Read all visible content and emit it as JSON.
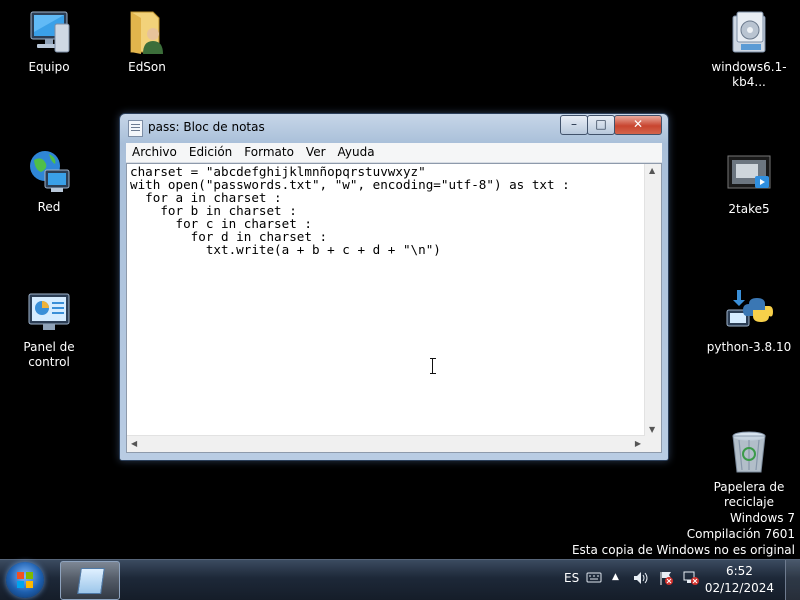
{
  "desktop": {
    "icons": [
      {
        "label": "Equipo",
        "icon": "computer-icon"
      },
      {
        "label": "EdSon",
        "icon": "user-folder-icon"
      },
      {
        "label": "Red",
        "icon": "network-globe-icon"
      },
      {
        "label": "Panel de control",
        "icon": "control-panel-icon"
      },
      {
        "label": "windows6.1-kb4...",
        "icon": "installer-package-icon"
      },
      {
        "label": "2take5",
        "icon": "video-file-icon"
      },
      {
        "label": "python-3.8.10",
        "icon": "python-installer-icon"
      },
      {
        "label": "Papelera de reciclaje",
        "icon": "recycle-bin-icon"
      }
    ],
    "watermark": [
      "Windows 7",
      "Compilación  7601",
      "Esta copia de Windows no es original"
    ]
  },
  "notepad": {
    "title": "pass: Bloc de notas",
    "controls": {
      "minimize": "–",
      "maximize": "□",
      "close": "✕"
    },
    "menu": [
      "Archivo",
      "Edición",
      "Formato",
      "Ver",
      "Ayuda"
    ],
    "content": "charset = \"abcdefghijklmnñopqrstuvwxyz\"\nwith open(\"passwords.txt\", \"w\", encoding=\"utf-8\") as txt :\n  for a in charset :\n    for b in charset :\n      for c in charset :\n        for d in charset :\n          txt.write(a + b + c + d + \"\\n\")"
  },
  "taskbar": {
    "language": "ES",
    "time": "6:52",
    "date": "02/12/2024",
    "tray_icons": [
      "keyboard-icon",
      "show-hidden-icons-icon",
      "volume-icon",
      "action-center-flag-icon",
      "network-disconnected-icon"
    ]
  },
  "colors": {
    "desktop": "#000000",
    "close_button": "#c8452f",
    "taskbar": "#1d2838"
  }
}
